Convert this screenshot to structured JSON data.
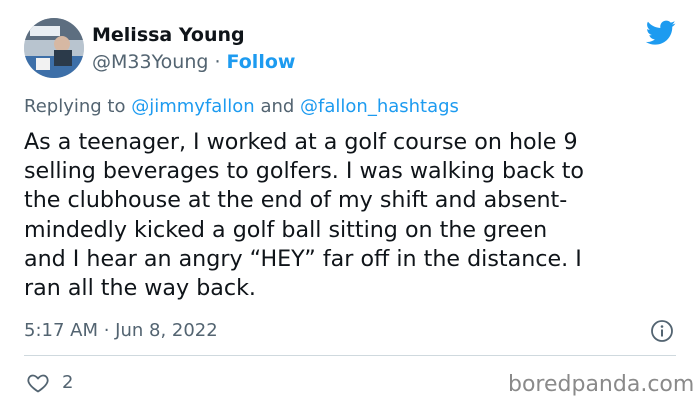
{
  "author": {
    "display_name": "Melissa Young",
    "handle": "@M33Young",
    "separator": " · ",
    "follow_label": "Follow",
    "avatar_icon": "profile-photo"
  },
  "brand": {
    "icon": "twitter-bird-icon",
    "color": "#1d9bf0"
  },
  "reply_context": {
    "prefix": "Replying to ",
    "mention_1": "@jimmyfallon",
    "joiner": " and ",
    "mention_2": "@fallon_hashtags"
  },
  "tweet": {
    "lines": [
      "As a teenager, I worked at a golf course on hole 9",
      "selling beverages to golfers. I was walking back to",
      "the clubhouse at the end of my shift and absent-",
      "mindedly kicked a golf ball sitting on the green",
      "and I hear an angry “HEY” far off in the distance.  I",
      "ran all the way back."
    ],
    "timestamp": "5:17 AM · Jun 8, 2022",
    "likes": "2"
  },
  "watermark": "boredpanda.com",
  "colors": {
    "text": "#0f1419",
    "secondary": "#536471",
    "link": "#1d9bf0",
    "divider": "#cfd9de"
  }
}
